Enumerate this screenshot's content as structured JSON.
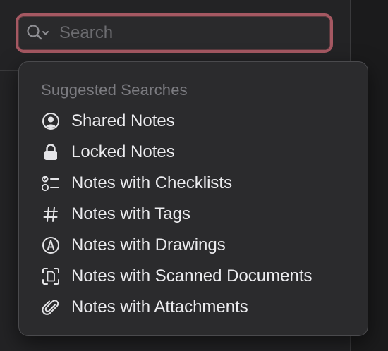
{
  "search": {
    "placeholder": "Search",
    "icon": "magnifier-with-chevron-icon",
    "focus_ring_color": "#a55862"
  },
  "suggestions": {
    "heading": "Suggested Searches",
    "items": [
      {
        "label": "Shared Notes",
        "icon": "person-circle-icon"
      },
      {
        "label": "Locked Notes",
        "icon": "lock-icon"
      },
      {
        "label": "Notes with Checklists",
        "icon": "checklist-icon"
      },
      {
        "label": "Notes with Tags",
        "icon": "hashtag-icon"
      },
      {
        "label": "Notes with Drawings",
        "icon": "pencil-tip-circle-icon"
      },
      {
        "label": "Notes with Scanned Documents",
        "icon": "scanned-document-icon"
      },
      {
        "label": "Notes with Attachments",
        "icon": "paperclip-icon"
      }
    ]
  },
  "colors": {
    "panel_background": "#2b2b2d",
    "text_primary": "#ececef",
    "text_secondary": "#7b7b80"
  }
}
